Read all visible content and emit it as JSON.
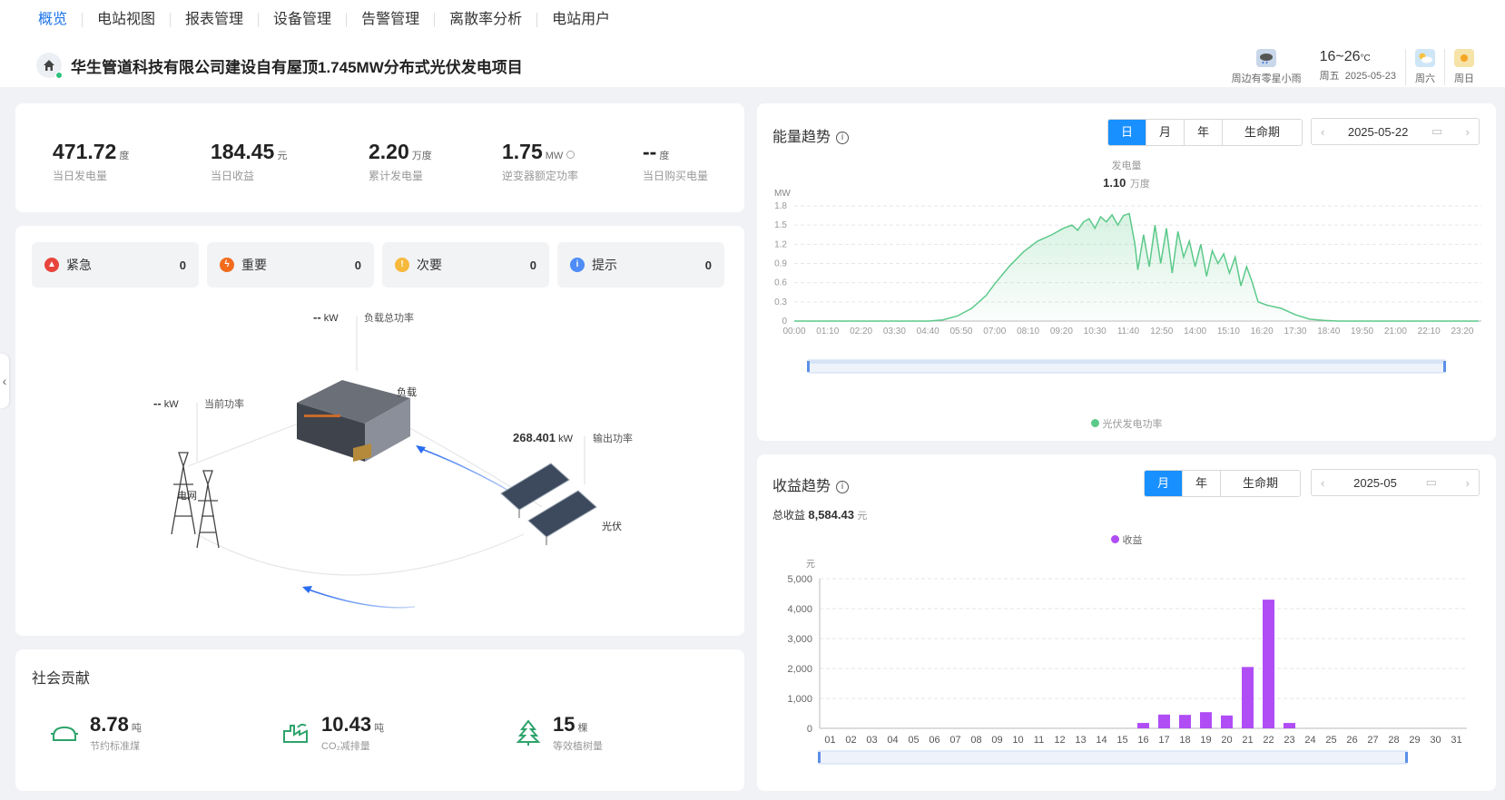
{
  "nav": [
    "概览",
    "电站视图",
    "报表管理",
    "设备管理",
    "告警管理",
    "离散率分析",
    "电站用户"
  ],
  "project_title": "华生管道科技有限公司建设自有屋顶1.745MW分布式光伏发电项目",
  "weather": {
    "today_desc": "周边有零星小雨",
    "temp": "16~26",
    "temp_unit": "°C",
    "today_day": "周五",
    "today_date": "2025-05-23",
    "day2": "周六",
    "day3": "周日",
    "colors": {
      "today": "#c9d7ea",
      "day2": "#cfe6f7",
      "day3": "#f6e3a8"
    }
  },
  "kpis": [
    {
      "value": "471.72",
      "unit": "度",
      "label": "当日发电量"
    },
    {
      "value": "184.45",
      "unit": "元",
      "label": "当日收益"
    },
    {
      "value": "2.20",
      "unit": "万度",
      "label": "累计发电量"
    },
    {
      "value": "1.75",
      "unit": "MW",
      "label": "逆变器额定功率"
    },
    {
      "value": "--",
      "unit": "度",
      "label": "当日购买电量"
    }
  ],
  "alarms": [
    {
      "label": "紧急",
      "count": "0",
      "color": "#e8453c"
    },
    {
      "label": "重要",
      "count": "0",
      "color": "#f26b1d"
    },
    {
      "label": "次要",
      "count": "0",
      "color": "#f6b93b"
    },
    {
      "label": "提示",
      "count": "0",
      "color": "#4e8cf7"
    }
  ],
  "flow": {
    "load_power_value": "--",
    "load_power_unit": "kW",
    "load_power_label": "负载总功率",
    "load_label": "负载",
    "grid_power_value": "--",
    "grid_power_unit": "kW",
    "grid_power_label": "当前功率",
    "grid_label": "电网",
    "pv_power_value": "268.401",
    "pv_power_unit": "kW",
    "pv_power_label": "输出功率",
    "pv_label": "光伏"
  },
  "social": {
    "title": "社会贡献",
    "items": [
      {
        "value": "8.78",
        "unit": "吨",
        "label": "节约标准煤"
      },
      {
        "value": "10.43",
        "unit": "吨",
        "label": "CO₂减排量"
      },
      {
        "value": "15",
        "unit": "棵",
        "label": "等效植树量"
      }
    ]
  },
  "energy": {
    "title": "能量趋势",
    "tabs": [
      "日",
      "月",
      "年",
      "生命期"
    ],
    "active_tab": "日",
    "date": "2025-05-22",
    "summary_label": "发电量",
    "summary_value": "1.10",
    "summary_unit": "万度",
    "legend": "光伏发电功率",
    "color": "#5cc98a"
  },
  "revenue": {
    "title": "收益趋势",
    "tabs": [
      "月",
      "年",
      "生命期"
    ],
    "active_tab": "月",
    "date": "2025-05",
    "total_label": "总收益",
    "total_value": "8,584.43",
    "total_unit": "元",
    "legend": "收益",
    "color": "#b04df5"
  },
  "chart_data": [
    {
      "type": "area",
      "title": "",
      "ylabel": "MW",
      "ylim": [
        0,
        1.8
      ],
      "yticks": [
        "0",
        "0.3",
        "0.6",
        "0.9",
        "1.2",
        "1.5",
        "1.8"
      ],
      "xticks": [
        "00:00",
        "01:10",
        "02:20",
        "03:30",
        "04:40",
        "05:50",
        "07:00",
        "08:10",
        "09:20",
        "10:30",
        "11:40",
        "12:50",
        "14:00",
        "15:10",
        "16:20",
        "17:30",
        "18:40",
        "19:50",
        "21:00",
        "22:10",
        "23:20"
      ],
      "series": [
        {
          "name": "光伏发电功率",
          "x": [
            0,
            4.7,
            5.2,
            5.7,
            6.2,
            6.7,
            7.0,
            7.5,
            8.0,
            8.5,
            9.0,
            9.4,
            9.7,
            9.9,
            10.1,
            10.3,
            10.5,
            10.7,
            10.9,
            11.1,
            11.3,
            11.5,
            11.7,
            11.9,
            12.0,
            12.2,
            12.4,
            12.6,
            12.8,
            13.0,
            13.2,
            13.4,
            13.6,
            13.8,
            14.0,
            14.2,
            14.4,
            14.6,
            14.8,
            15.0,
            15.2,
            15.4,
            15.6,
            15.8,
            16.0,
            16.2,
            16.5,
            17.0,
            17.5,
            18.0,
            18.5,
            19.0,
            23.9
          ],
          "y": [
            0,
            0,
            0.02,
            0.08,
            0.2,
            0.4,
            0.58,
            0.85,
            1.08,
            1.25,
            1.35,
            1.45,
            1.5,
            1.42,
            1.55,
            1.6,
            1.45,
            1.63,
            1.55,
            1.66,
            1.5,
            1.65,
            1.68,
            1.2,
            0.8,
            1.35,
            0.85,
            1.5,
            0.9,
            1.45,
            0.75,
            1.4,
            1.0,
            1.25,
            0.85,
            1.2,
            0.7,
            1.1,
            0.9,
            1.05,
            0.75,
            1.0,
            0.55,
            0.85,
            0.6,
            0.3,
            0.25,
            0.2,
            0.1,
            0.03,
            0.01,
            0,
            0
          ]
        }
      ]
    },
    {
      "type": "bar",
      "title": "",
      "ylabel": "元",
      "ylim": [
        0,
        5000
      ],
      "yticks": [
        "0",
        "1,000",
        "2,000",
        "3,000",
        "4,000",
        "5,000"
      ],
      "categories": [
        "01",
        "02",
        "03",
        "04",
        "05",
        "06",
        "07",
        "08",
        "09",
        "10",
        "11",
        "12",
        "13",
        "14",
        "15",
        "16",
        "17",
        "18",
        "19",
        "20",
        "21",
        "22",
        "23",
        "24",
        "25",
        "26",
        "27",
        "28",
        "29",
        "30",
        "31"
      ],
      "series": [
        {
          "name": "收益",
          "values": [
            0,
            0,
            0,
            0,
            0,
            0,
            0,
            0,
            0,
            0,
            0,
            0,
            0,
            0,
            0,
            180,
            460,
            450,
            540,
            430,
            2050,
            4300,
            180,
            0,
            0,
            0,
            0,
            0,
            0,
            0,
            0
          ]
        }
      ]
    }
  ]
}
